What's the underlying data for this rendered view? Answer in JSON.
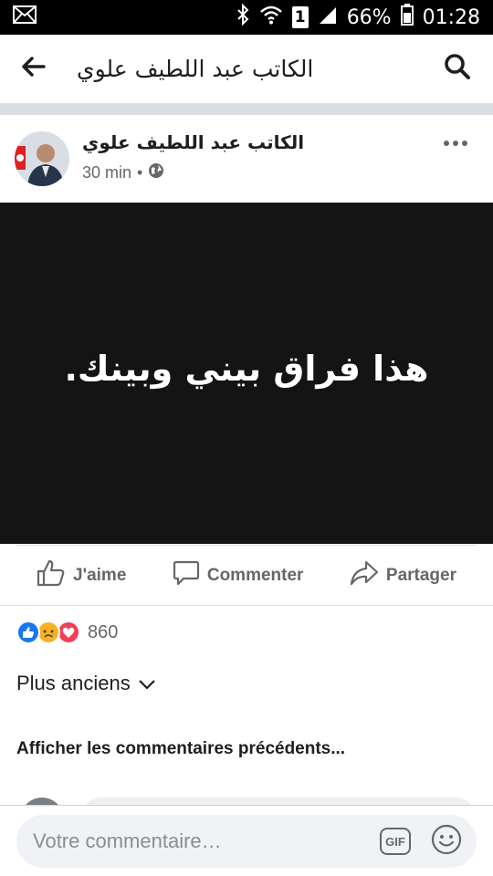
{
  "status_bar": {
    "battery": "66%",
    "time": "01:28",
    "sim": "1",
    "icons": [
      "mail-icon",
      "bluetooth-icon",
      "wifi-icon",
      "sim-icon",
      "signal-icon",
      "battery-icon"
    ]
  },
  "header": {
    "title": "الكاتب عبد اللطيف علوي",
    "icons": [
      "back-arrow-icon",
      "search-icon"
    ]
  },
  "post": {
    "author": "الكاتب عبد اللطيف علوي",
    "time": "30 min",
    "separator": "•",
    "privacy_icon": "globe-icon",
    "text": "هذا فراق بيني وبينك.",
    "background_color": "#141414"
  },
  "actions": [
    {
      "label": "J'aime",
      "icon": "thumbs-up-icon"
    },
    {
      "label": "Commenter",
      "icon": "comment-icon"
    },
    {
      "label": "Partager",
      "icon": "share-icon"
    }
  ],
  "reactions": {
    "types": [
      "like",
      "sad",
      "love"
    ],
    "count": "860"
  },
  "comments": {
    "sort_label": "Plus anciens",
    "previous_label": "Afficher les commentaires précédents..."
  },
  "composer": {
    "placeholder": "Votre commentaire…",
    "gif_label": "GIF"
  },
  "colors": {
    "accent": "#1877f2",
    "love": "#f33e58",
    "sad": "#f7b125"
  }
}
